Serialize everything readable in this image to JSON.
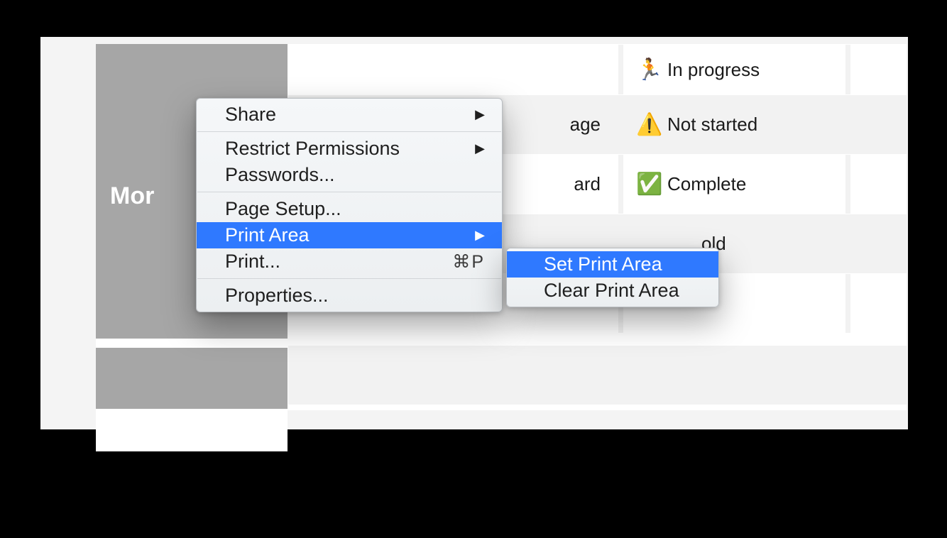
{
  "sidebar": {
    "label": "Mor"
  },
  "rows": [
    {
      "task_suffix": "",
      "status_icon": "🏃",
      "status_label": "In progress"
    },
    {
      "task_suffix": "age",
      "status_icon": "⚠️",
      "status_label": "Not started"
    },
    {
      "task_suffix": "ard",
      "status_icon": "✅",
      "status_label": "Complete"
    },
    {
      "task_suffix": "",
      "status_icon": "",
      "status_label": "old"
    }
  ],
  "menu": {
    "share": "Share",
    "restrict": "Restrict Permissions",
    "passwords": "Passwords...",
    "page_setup": "Page Setup...",
    "print_area": "Print Area",
    "print": "Print...",
    "print_shortcut": "⌘P",
    "properties": "Properties..."
  },
  "submenu": {
    "set": "Set Print Area",
    "clear": "Clear Print Area"
  }
}
